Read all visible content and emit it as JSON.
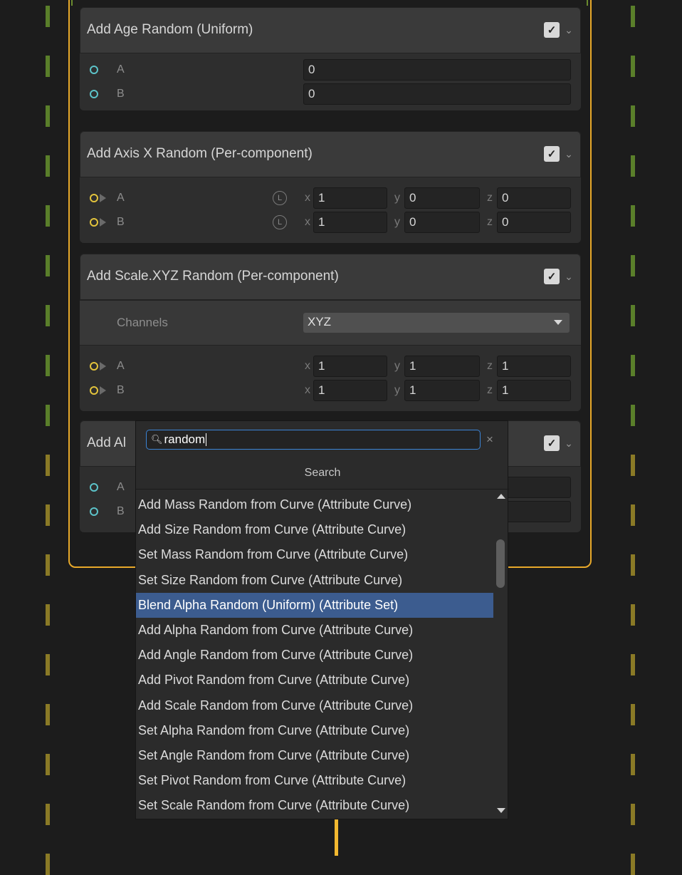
{
  "colors": {
    "graph_bg": "#1c1c1c",
    "block_frame": "#e8a92a",
    "flow_wire": "#f2b830",
    "port_float": "#5cc3c9",
    "port_vector": "#e2c33c",
    "selection": "#3c5c8f",
    "search_focus": "#3b84d6"
  },
  "blocks": [
    {
      "title": "Add Age Random (Uniform)",
      "rows": [
        {
          "label": "A",
          "value": "0"
        },
        {
          "label": "B",
          "value": "0"
        }
      ]
    },
    {
      "title": "Add Axis X Random (Per-component)",
      "rows": [
        {
          "label": "A",
          "space_icon": "L",
          "x": "1",
          "y": "0",
          "z": "0"
        },
        {
          "label": "B",
          "space_icon": "L",
          "x": "1",
          "y": "0",
          "z": "0"
        }
      ]
    },
    {
      "title": "Add Scale.XYZ Random (Per-component)",
      "channels_label": "Channels",
      "channels_value": "XYZ",
      "rows": [
        {
          "label": "A",
          "x": "1",
          "y": "1",
          "z": "1"
        },
        {
          "label": "B",
          "x": "1",
          "y": "1",
          "z": "1"
        }
      ]
    },
    {
      "title_visible": "Add Al",
      "rows": [
        {
          "label": "A"
        },
        {
          "label": "B"
        }
      ]
    }
  ],
  "axis_labels": {
    "x": "x",
    "y": "y",
    "z": "z"
  },
  "search": {
    "icon": "magnifier-icon",
    "query": "random",
    "clear_symbol": "×",
    "title": "Search",
    "selected_index": 4,
    "results": [
      "Add Mass Random from Curve (Attribute Curve)",
      "Add Size Random from Curve (Attribute Curve)",
      "Set Mass Random from Curve (Attribute Curve)",
      "Set Size Random from Curve (Attribute Curve)",
      "Blend Alpha Random (Uniform) (Attribute Set)",
      "Add Alpha Random from Curve (Attribute Curve)",
      "Add Angle Random from Curve (Attribute Curve)",
      "Add Pivot Random from Curve (Attribute Curve)",
      "Add Scale Random from Curve (Attribute Curve)",
      "Set Alpha Random from Curve (Attribute Curve)",
      "Set Angle Random from Curve (Attribute Curve)",
      "Set Pivot Random from Curve (Attribute Curve)",
      "Set Scale Random from Curve (Attribute Curve)"
    ]
  }
}
